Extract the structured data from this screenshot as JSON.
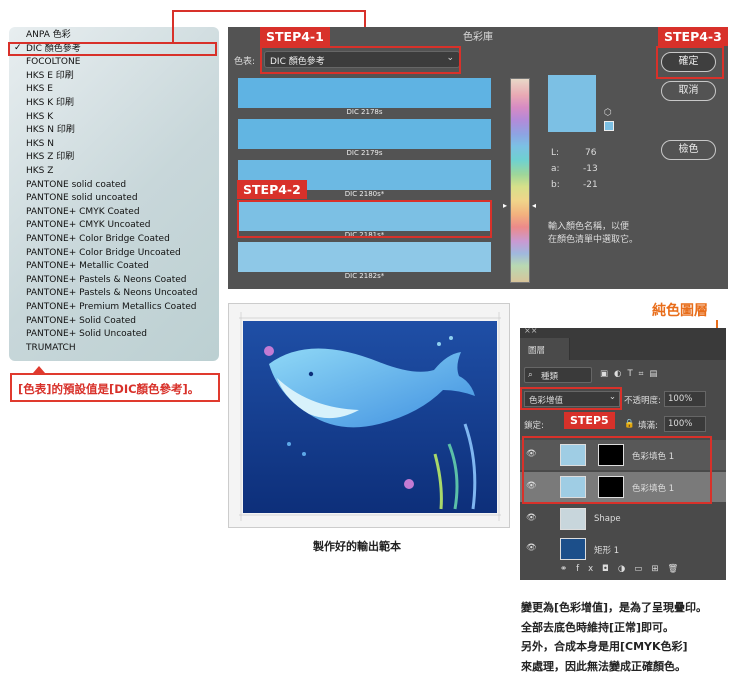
{
  "library_menu": {
    "selected_index": 1,
    "items": [
      "ANPA 色彩",
      "DIC 顏色參考",
      "FOCOLTONE",
      "HKS E 印刷",
      "HKS E",
      "HKS K 印刷",
      "HKS K",
      "HKS N 印刷",
      "HKS N",
      "HKS Z 印刷",
      "HKS Z",
      "PANTONE solid coated",
      "PANTONE solid uncoated",
      "PANTONE+ CMYK Coated",
      "PANTONE+ CMYK Uncoated",
      "PANTONE+ Color Bridge Coated",
      "PANTONE+ Color Bridge Uncoated",
      "PANTONE+ Metallic Coated",
      "PANTONE+ Pastels & Neons Coated",
      "PANTONE+ Pastels & Neons Uncoated",
      "PANTONE+ Premium Metallics Coated",
      "PANTONE+ Solid Coated",
      "PANTONE+ Solid Uncoated",
      "TRUMATCH"
    ],
    "check": "✓"
  },
  "caption_left": "[色表]的預設值是[DIC顏色參考]。",
  "dialog": {
    "title": "色彩庫",
    "library_label": "色表:",
    "library_value": "DIC 顏色參考",
    "swatches": [
      {
        "label": "DIC 2178s",
        "color": "#5fb3e3"
      },
      {
        "label": "DIC 2179s",
        "color": "#62b5e2"
      },
      {
        "label": "DIC 2180s*",
        "color": "#6cb9e3"
      },
      {
        "label": "DIC 2181s*",
        "color": "#7cc0e4"
      },
      {
        "label": "DIC 2182s*",
        "color": "#8ec8e7"
      }
    ],
    "preview_color": "#7cc0e4",
    "lab": {
      "L_label": "L:",
      "L": "76",
      "a_label": "a:",
      "a": "-13",
      "b_label": "b:",
      "b": "-21"
    },
    "hint": [
      "輸入顏色名稱，以便",
      "在顏色清單中選取它。"
    ],
    "ok": "確定",
    "cancel": "取消",
    "picker": "檢色"
  },
  "steps": {
    "s41": "STEP4-1",
    "s42": "STEP4-2",
    "s43": "STEP4-3",
    "s5": "STEP5"
  },
  "sample_caption": "製作好的輸出範本",
  "solid_layer_title": "純色圖層",
  "layers": {
    "tab": "圖層",
    "filter": "種類",
    "blend_mode": "色彩增值",
    "opacity_label": "不透明度:",
    "opacity": "100%",
    "lock_label": "鎖定:",
    "fill_label": "填滿:",
    "fill": "100%",
    "rows": [
      "色彩填色 1",
      "色彩填色 1",
      "Shape",
      "矩形 1"
    ]
  },
  "caption_right": [
    "變更為[色彩增值]，是為了呈現疊印。",
    "全部去底色時維持[正常]即可。",
    "另外，合成本身是用[CMYK色彩]",
    "來處理，因此無法變成正確顏色。"
  ]
}
